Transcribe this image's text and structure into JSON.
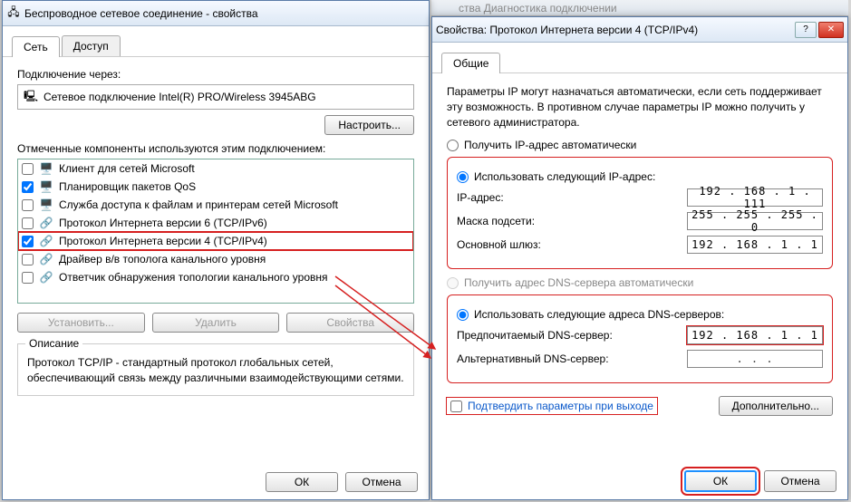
{
  "win1": {
    "title": "Беспроводное сетевое соединение - свойства",
    "tabs": [
      "Сеть",
      "Доступ"
    ],
    "connect_via_label": "Подключение через:",
    "adapter_name": "Сетевое подключение Intel(R) PRO/Wireless 3945ABG",
    "configure_btn": "Настроить...",
    "components_label": "Отмеченные компоненты используются этим подключением:",
    "items": [
      {
        "checked": false,
        "label": "Клиент для сетей Microsoft"
      },
      {
        "checked": true,
        "label": "Планировщик пакетов QoS"
      },
      {
        "checked": false,
        "label": "Служба доступа к файлам и принтерам сетей Microsoft"
      },
      {
        "checked": false,
        "label": "Протокол Интернета версии 6 (TCP/IPv6)"
      },
      {
        "checked": true,
        "label": "Протокол Интернета версии 4 (TCP/IPv4)",
        "hl": true
      },
      {
        "checked": false,
        "label": "Драйвер в/в тополога канального уровня"
      },
      {
        "checked": false,
        "label": "Ответчик обнаружения топологии канального уровня"
      }
    ],
    "install_btn": "Установить...",
    "remove_btn": "Удалить",
    "props_btn": "Свойства",
    "desc_title": "Описание",
    "desc_text": "Протокол TCP/IP - стандартный протокол глобальных сетей, обеспечивающий связь между различными взаимодействующими сетями.",
    "ok": "ОК",
    "cancel": "Отмена"
  },
  "win2": {
    "top_strip": "ства      Диагностика подключении",
    "title": "Свойства: Протокол Интернета версии 4 (TCP/IPv4)",
    "tab": "Общие",
    "info": "Параметры IP могут назначаться автоматически, если сеть поддерживает эту возможность. В противном случае параметры IP можно получить у сетевого администратора.",
    "r_auto_ip": "Получить IP-адрес автоматически",
    "r_manual_ip": "Использовать следующий IP-адрес:",
    "f_ip_label": "IP-адрес:",
    "f_ip_val": "192 . 168 .  1  . 111",
    "f_mask_label": "Маска подсети:",
    "f_mask_val": "255 . 255 . 255 .  0",
    "f_gw_label": "Основной шлюз:",
    "f_gw_val": "192 . 168 .  1  .  1",
    "r_auto_dns": "Получить адрес DNS-сервера автоматически",
    "r_manual_dns": "Использовать следующие адреса DNS-серверов:",
    "f_dns1_label": "Предпочитаемый DNS-сервер:",
    "f_dns1_val": "192 . 168 .  1  .  1",
    "f_dns2_label": "Альтернативный DNS-сервер:",
    "f_dns2_val": " .       .       . ",
    "confirm_chk": "Подтвердить параметры при выходе",
    "advanced_btn": "Дополнительно...",
    "ok": "ОК",
    "cancel": "Отмена"
  }
}
